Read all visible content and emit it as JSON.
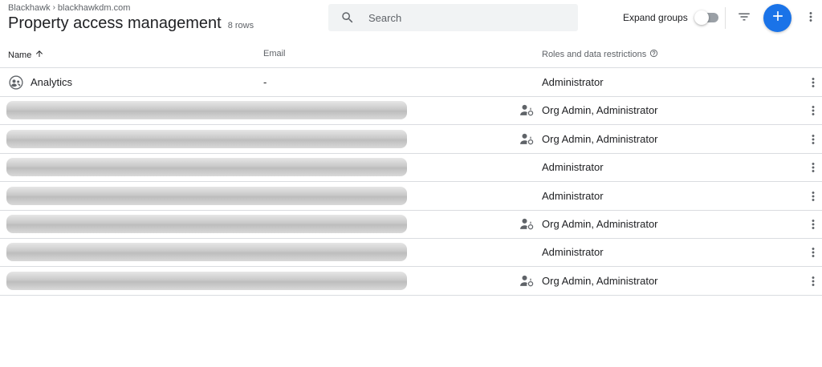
{
  "header": {
    "breadcrumb": [
      "Blackhawk",
      "blackhawkdm.com"
    ],
    "breadcrumb_separator": "›",
    "title": "Property access management",
    "row_count": "8 rows"
  },
  "search": {
    "placeholder": "Search",
    "value": ""
  },
  "toolbar": {
    "expand_groups_label": "Expand groups",
    "expand_groups_on": false,
    "filter_icon": "filter-icon",
    "add_icon": "plus-icon",
    "more_icon": "more-vert-icon",
    "accent_color": "#1a73e8"
  },
  "table": {
    "columns": {
      "name": "Name",
      "email": "Email",
      "roles": "Roles and data restrictions"
    },
    "sort": "name-ascending",
    "rows": [
      {
        "name": "Analytics",
        "email": "-",
        "roles": "Administrator",
        "redacted": false,
        "org_admin_icon": false,
        "name_icon": "group-icon"
      },
      {
        "name": "",
        "email": "",
        "roles": "Org Admin, Administrator",
        "redacted": true,
        "org_admin_icon": true
      },
      {
        "name": "",
        "email": "",
        "roles": "Org Admin, Administrator",
        "redacted": true,
        "org_admin_icon": true
      },
      {
        "name": "",
        "email": "",
        "roles": "Administrator",
        "redacted": true,
        "org_admin_icon": false
      },
      {
        "name": "",
        "email": "",
        "roles": "Administrator",
        "redacted": true,
        "org_admin_icon": false
      },
      {
        "name": "",
        "email": "",
        "roles": "Org Admin, Administrator",
        "redacted": true,
        "org_admin_icon": true
      },
      {
        "name": "",
        "email": "",
        "roles": "Administrator",
        "redacted": true,
        "org_admin_icon": false
      },
      {
        "name": "",
        "email": "",
        "roles": "Org Admin, Administrator",
        "redacted": true,
        "org_admin_icon": true
      }
    ]
  }
}
